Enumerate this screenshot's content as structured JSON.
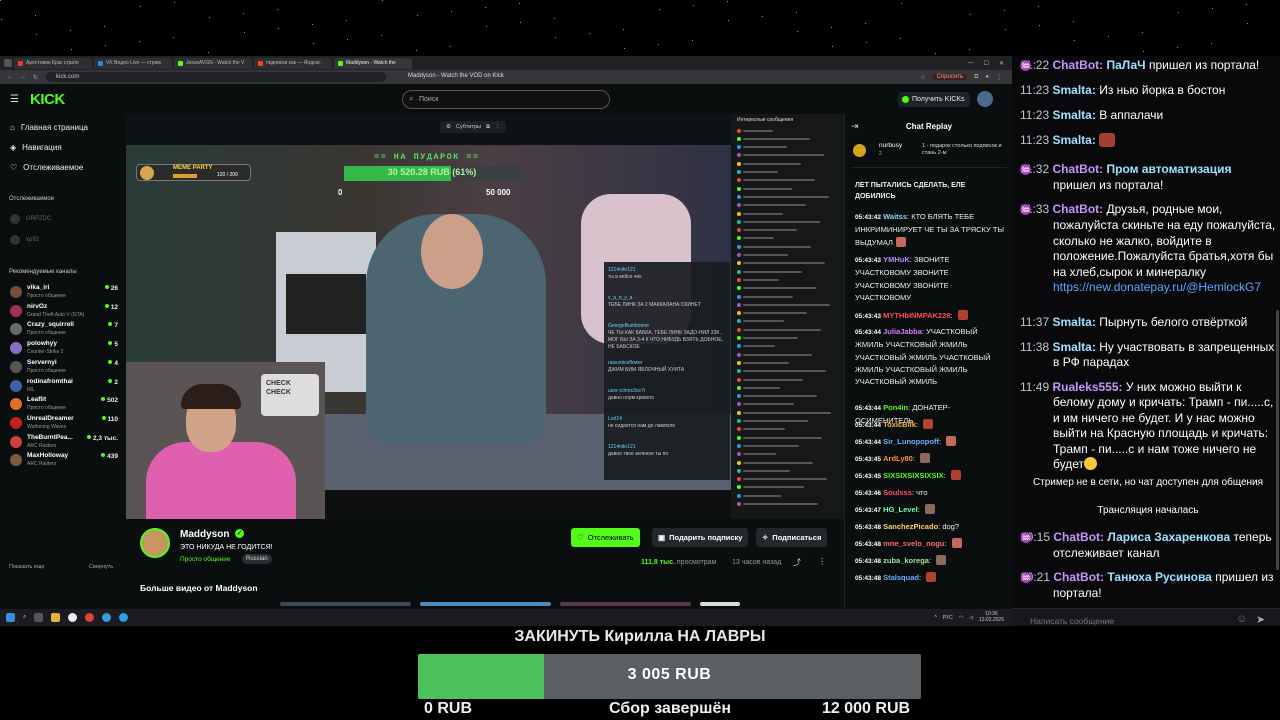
{
  "browser": {
    "tabs": [
      {
        "label": "Арестовин Краг страте",
        "color": "#e33"
      },
      {
        "label": "VK Видео Live — стрим",
        "color": "#2787f5"
      },
      {
        "label": "JesusAVGN - Watch the V",
        "color": "#53fc18"
      },
      {
        "label": "подписки как — Яндекс",
        "color": "#fc3f1d"
      },
      {
        "label": "Maddyson - Watch the",
        "color": "#53fc18"
      }
    ],
    "url": "kick.com",
    "page_title": "Maddyson - Watch the VOD on Kick",
    "spr_label": "Спросить"
  },
  "kick": {
    "logo": "KICK",
    "search_placeholder": "Поиск",
    "get_kicks": "Получить KICKs",
    "nav": [
      {
        "label": "Главная страница",
        "icon": "home-icon",
        "glyph": "⌂"
      },
      {
        "label": "Навигация",
        "icon": "compass-icon",
        "glyph": "◈"
      },
      {
        "label": "Отслеживаемое",
        "icon": "heart-icon",
        "glyph": "♡"
      }
    ],
    "followed_header": "Отслеживаемое",
    "followed": [
      "GRPZDC",
      "xp92"
    ],
    "recommended_header": "Рекомендуемые каналы",
    "recommended": [
      {
        "name": "vika_iri",
        "cat": "Просто общение",
        "viewers": "26",
        "color": "#7a4a3a"
      },
      {
        "name": "nirvOz",
        "cat": "Grand Theft Auto V (GTA)",
        "viewers": "12",
        "color": "#a03050"
      },
      {
        "name": "Crazy_squirrell",
        "cat": "Просто общение",
        "viewers": "7",
        "color": "#6a6a6a"
      },
      {
        "name": "polowhyy",
        "cat": "Counter-Strike 2",
        "viewers": "5",
        "color": "#8a70c0"
      },
      {
        "name": "Servernyi",
        "cat": "Просто общение",
        "viewers": "4",
        "color": "#555"
      },
      {
        "name": "rodinafromthai",
        "cat": "IRL",
        "viewers": "2",
        "color": "#4060a0"
      },
      {
        "name": "Leaflit",
        "cat": "Просто общение",
        "viewers": "502",
        "color": "#e07020"
      },
      {
        "name": "UnrealDreamer",
        "cat": "Wuthering Waves",
        "viewers": "110",
        "color": "#c02020"
      },
      {
        "name": "TheBurntPea...",
        "cat": "ARC Raiders",
        "viewers": "2,3 тыс.",
        "color": "#d04040"
      },
      {
        "name": "MaxHolloway",
        "cat": "ARC Raiders",
        "viewers": "439",
        "color": "#7a5a40"
      }
    ],
    "show_more": "Показать еще",
    "collapse": "Свернуть"
  },
  "video": {
    "subtitles": "Субтитры",
    "alert_title": "== НА ПУДАРОК ==",
    "alert_amount": "30 520.28 RUB (61%)",
    "alert_progress": 0.61,
    "alert_min": "0",
    "alert_max": "50 000",
    "meme_label": "MEME PARTY",
    "meme_count": "120 / 200",
    "meme_progress": 0.6,
    "webcam_sign": "CHECK CHECK",
    "inner_chat": [
      {
        "user": "1214nikr121",
        "text": "ты в кейсе чек"
      },
      {
        "user": "v_a_n_y_a",
        "text": "ТЕБЕ ЛИНК ЗА 2 МАККАЛАНА СКИНЕТ"
      },
      {
        "user": "GeorgeBumbonne",
        "text": "ЧЕ ТЫ КАК БАБКА, ТЕБЕ ЛИНК ЗАДО-НИЛ 33К , МОГ БЫ ЗА 3-4 К ЧТО НИБУДЬ ВЗЯТЬ ДОБНОЕ, НЕ БАБСКОЕ"
      },
      {
        "user": "raisumiceflower",
        "text": "ДЖИМ БИМ ЯБЛОЧНЫЙ ХУИТА"
      },
      {
        "user": "user-rchmx3ce7r",
        "text": "давно норм кривого"
      },
      {
        "user": "Lorl14",
        "text": "не сидается нам до ламполе"
      },
      {
        "user": "1214nikr121",
        "text": "давно твое зеленое ты по"
      }
    ],
    "vod_chat_header": "Интересные сообщения"
  },
  "channel": {
    "name": "Maddyson",
    "title": "ЭТО НИКУДА НЕ ГОДИТСЯ!",
    "category": "Просто общение",
    "language": "Russian",
    "follow": "Отслеживать",
    "gift": "Подарить подписку",
    "subscribe": "Подписаться",
    "views": "111,8 тыс.",
    "views_label": "просмотрам",
    "ago": "13 часов назад",
    "more_videos": "Больше видео от Maddyson"
  },
  "replay": {
    "title": "Chat Replay",
    "pinned_user": "nurbusy",
    "pinned_sub": "2",
    "pinned_text": "1 - подарок столько подписок и стань 2-м",
    "first": "ЛЕТ ПЫТАЛИСЬ СДЕЛАТЬ, ЕЛЕ ДОБИЛИСЬ",
    "messages": [
      {
        "t": "05:43:42",
        "u": "Waitss",
        "c": "#8fd4ff",
        "m": "КТО БЛЯТЬ ТЕБЕ ИНКРИМИНИРУЕТ ЧЕ ТЫ ЗА ТРЯСКУ ТЫ ВЫДУМАЛ"
      },
      {
        "t": "05:43:43",
        "u": "YMHuK",
        "c": "#b48cff",
        "m": "ЗВОНИТЕ УЧАСТКОВОМУ ЗВОНИТЕ УЧАСТКОВОМУ ЗВОНИТЕ УЧАСТКОВОМУ"
      },
      {
        "t": "05:43:43",
        "u": "MYTHbINMPAK228",
        "c": "#ff4d4d",
        "m": ""
      },
      {
        "t": "05:43:44",
        "u": "JuliaJabba",
        "c": "#d77bff",
        "m": "УЧАСТКОВЫЙ ЖМИЛЬ УЧАСТКОВЫЙ ЖМИЛЬ УЧАСТКОВЫЙ ЖМИЛЬ УЧАСТКОВЫЙ ЖМИЛЬ УЧАСТКОВЫЙ ЖМИЛЬ УЧАСТКОВЫЙ ЖМИЛЬ"
      },
      {
        "t": "05:43:44",
        "u": "Pon4in",
        "c": "#53fc18",
        "m": "ДОНАТЕР-ОСИМЕНИТЕЛЬ"
      },
      {
        "t": "05:43:44",
        "u": "ToxicBlik",
        "c": "#ffb347",
        "m": ""
      },
      {
        "t": "05:43:44",
        "u": "Sir_Lunopopoff",
        "c": "#6ab0ff",
        "m": ""
      },
      {
        "t": "05:43:45",
        "u": "ArdLy80",
        "c": "#ff8c42",
        "m": ""
      },
      {
        "t": "05:43:45",
        "u": "SIXSIXSIXSIXSIX",
        "c": "#53fc18",
        "m": ""
      },
      {
        "t": "05:43:46",
        "u": "Soulsss",
        "c": "#ff4d6d",
        "m": "что"
      },
      {
        "t": "05:43:47",
        "u": "HG_Level",
        "c": "#7bffb0",
        "m": ""
      },
      {
        "t": "05:43:48",
        "u": "SanchezPicado",
        "c": "#ffd166",
        "m": "dog?"
      },
      {
        "t": "05:43:48",
        "u": "mne_svelo_nogu",
        "c": "#ff6b6b",
        "m": ""
      },
      {
        "t": "05:43:48",
        "u": "zuba_korega",
        "c": "#a0e0a0",
        "m": ""
      },
      {
        "t": "05:43:48",
        "u": "Stalsquad",
        "c": "#6ab0ff",
        "m": ""
      }
    ]
  },
  "taskbar": {
    "lang": "РУС",
    "time": "10:36",
    "date": "13.02.2026"
  },
  "chat": {
    "messages": [
      {
        "time": "11:22",
        "bot": "ChatBot:",
        "name": "ПаЛаЧ",
        "name_color": "#9fe0ff",
        "text": "пришел из портала!"
      },
      {
        "time": "11:23",
        "user": "Smalta:",
        "user_color": "#9fe0ff",
        "text": "Из нью йорка в бостон"
      },
      {
        "time": "11:23",
        "user": "Smalta:",
        "user_color": "#9fe0ff",
        "text": "В аппалачи"
      },
      {
        "time": "11:23",
        "user": "Smalta:",
        "user_color": "#9fe0ff",
        "text": ""
      },
      {
        "time": "11:32",
        "bot": "ChatBot:",
        "name": "Пром автоматизация",
        "name_color": "#9fe0ff",
        "text": "пришел из портала!"
      },
      {
        "time": "11:33",
        "bot": "ChatBot:",
        "text": "Друзья, родные мои, пожалуйста скиньте на еду пожалуйста, сколько не жалко, войдите в положение.Пожалуйста братья,хотя бы на хлеб,сырок и минералку",
        "link": "https://new.donatepay.ru/@HemlockG7"
      },
      {
        "time": "11:37",
        "user": "Smalta:",
        "user_color": "#9fe0ff",
        "text": "Пырнуть белого отвёрткой"
      },
      {
        "time": "11:38",
        "user": "Smalta:",
        "user_color": "#9fe0ff",
        "text": "Ну участвовать в запрещенных в РФ парадах"
      },
      {
        "time": "11:49",
        "user": "Rualeks555:",
        "user_color": "#c794ff",
        "text": "У них можно выйти к белому дому и кричать: Трамп - пи.....с, и им ничего не будет. И у нас можно выйти на Красную площадь и кричать: Трамп - пи.....с и нам тоже ничего не будет"
      },
      {
        "system": "Стример не в сети, но чат доступен для общения"
      },
      {
        "system": "Трансляция началась"
      },
      {
        "time": "10:15",
        "bot": "ChatBot:",
        "name": "Лариса Захаренкова",
        "name_color": "#9fe0ff",
        "text": "теперь отслеживает канал"
      },
      {
        "time": "10:21",
        "bot": "ChatBot:",
        "name": "Танюха Русинова",
        "name_color": "#9fe0ff",
        "text": "пришел из портала!"
      }
    ],
    "input_placeholder": "Написать сообщение"
  },
  "goal": {
    "title": "ЗАКИНУТЬ Кирилла НА ЛАВРЫ",
    "amount": "3 005 RUB",
    "progress": 0.25,
    "min": "0 RUB",
    "status": "Сбор завершён",
    "max": "12 000 RUB"
  },
  "colors": {
    "kick_green": "#53fc18",
    "goal_green": "#4bc259",
    "bot_purple": "#c794ff"
  }
}
